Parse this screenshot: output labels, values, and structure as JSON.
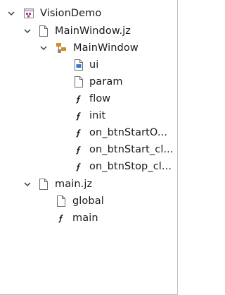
{
  "tree": {
    "root": {
      "label": "VisionDemo",
      "icon": "project-icon",
      "expanded": true,
      "children": [
        {
          "label": "MainWindow.jz",
          "icon": "file-icon",
          "expanded": true,
          "children": [
            {
              "label": "MainWindow",
              "icon": "class-icon",
              "expanded": true,
              "members": [
                {
                  "label": "ui",
                  "icon": "ui-file-icon"
                },
                {
                  "label": "param",
                  "icon": "file-icon"
                },
                {
                  "label": "flow",
                  "icon": "function-icon"
                },
                {
                  "label": "init",
                  "icon": "function-icon"
                },
                {
                  "label": "on_btnStartO...",
                  "icon": "function-icon"
                },
                {
                  "label": "on_btnStart_cl...",
                  "icon": "function-icon"
                },
                {
                  "label": "on_btnStop_cl...",
                  "icon": "function-icon"
                }
              ]
            }
          ]
        },
        {
          "label": "main.jz",
          "icon": "file-icon",
          "expanded": true,
          "members": [
            {
              "label": "global",
              "icon": "file-icon"
            },
            {
              "label": "main",
              "icon": "function-icon"
            }
          ]
        }
      ]
    }
  },
  "colors": {
    "text": "#1a1a1a",
    "chevron": "#3c3c3c",
    "project_accent": "#b03a8c",
    "class_accent": "#d98a1c",
    "function_icon": "#1a1a1a",
    "ui_accent": "#3a78c8",
    "border": "#bfbfbf"
  }
}
